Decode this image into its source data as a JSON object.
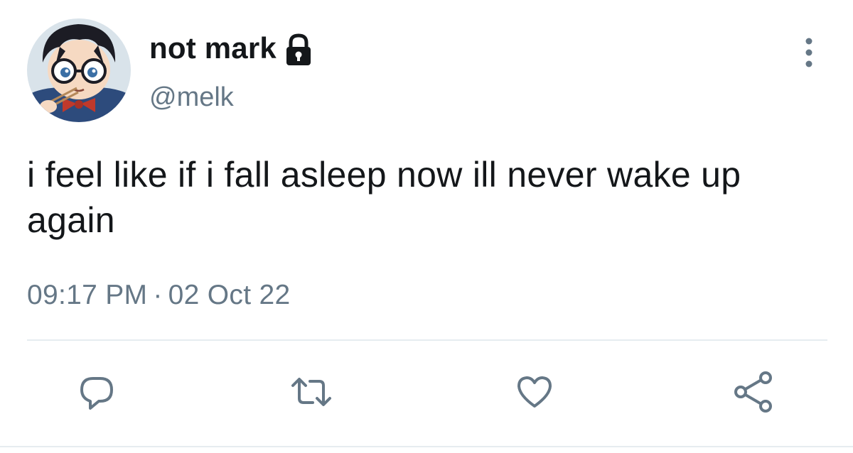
{
  "user": {
    "display_name": "not mark",
    "handle": "@melk",
    "protected_icon": "lock-icon",
    "avatar_icon": "avatar-anime-boy-glasses"
  },
  "tweet": {
    "text": "i feel like if i fall asleep now ill never wake up again",
    "time": "09:17 PM",
    "separator": "·",
    "date": "02 Oct 22"
  },
  "menu": {
    "more_icon": "more-vertical-icon"
  },
  "actions": [
    {
      "name": "reply",
      "icon": "reply-icon"
    },
    {
      "name": "retweet",
      "icon": "retweet-icon"
    },
    {
      "name": "like",
      "icon": "heart-icon"
    },
    {
      "name": "share",
      "icon": "share-icon"
    }
  ],
  "colors": {
    "text_primary": "#14171a",
    "text_secondary": "#657786",
    "icon": "#657786",
    "divider": "#e6ecf0"
  }
}
